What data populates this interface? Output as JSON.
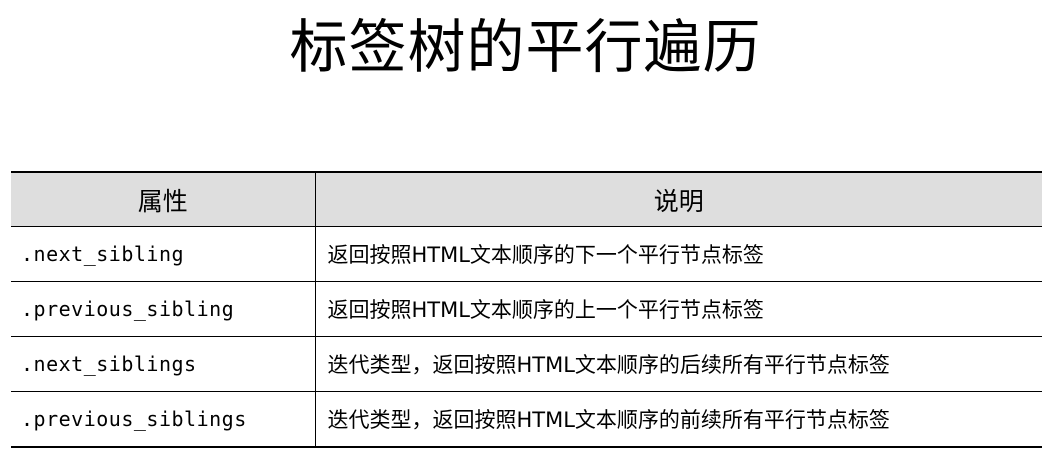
{
  "title": "标签树的平行遍历",
  "table": {
    "headers": [
      "属性",
      "说明"
    ],
    "rows": [
      {
        "attr": ".next_sibling",
        "desc": "返回按照HTML文本顺序的下一个平行节点标签"
      },
      {
        "attr": ".previous_sibling",
        "desc": "返回按照HTML文本顺序的上一个平行节点标签"
      },
      {
        "attr": ".next_siblings",
        "desc": "迭代类型，返回按照HTML文本顺序的后续所有平行节点标签"
      },
      {
        "attr": ".previous_siblings",
        "desc": "迭代类型，返回按照HTML文本顺序的前续所有平行节点标签"
      }
    ]
  },
  "colors": {
    "header_bg": "#dedede",
    "border": "#000000"
  }
}
